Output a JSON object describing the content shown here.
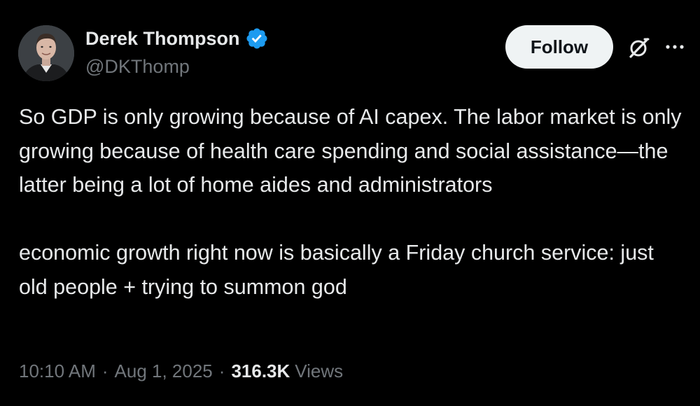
{
  "author": {
    "display_name": "Derek Thompson",
    "handle": "@DKThomp",
    "verified": true,
    "verified_color": "#1d9bf0"
  },
  "actions": {
    "follow_label": "Follow",
    "grok_icon": "grok-slash-circle-icon",
    "more_icon": "more-horizontal-icon"
  },
  "tweet": {
    "paragraph_1": "So GDP is only growing because of AI capex. The labor market is only growing because of health care spending and social assistance—the latter being a lot of home aides and administrators",
    "paragraph_2": "economic growth right now is basically a Friday church service: just old people + trying to summon god"
  },
  "meta": {
    "time": "10:10 AM",
    "date": "Aug 1, 2025",
    "separator": "·",
    "views_count": "316.3K",
    "views_label": "Views"
  },
  "colors": {
    "background": "#000000",
    "text_primary": "#e7e9ea",
    "text_secondary": "#71767b",
    "follow_bg": "#eff3f4"
  }
}
